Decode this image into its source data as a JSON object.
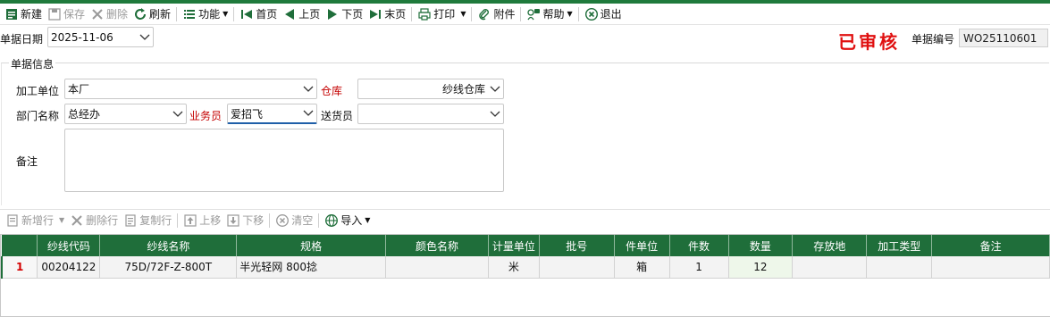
{
  "toolbar": {
    "new": "新建",
    "save": "保存",
    "delete": "删除",
    "refresh": "刷新",
    "functions": "功能",
    "first": "首页",
    "prev": "上页",
    "next": "下页",
    "last": "末页",
    "print": "打印",
    "attachment": "附件",
    "help": "帮助",
    "exit": "退出"
  },
  "header": {
    "date_label": "单据日期",
    "date_value": "2025-11-06",
    "status": "已审核",
    "doc_no_label": "单据编号",
    "doc_no_value": "WO25110601"
  },
  "form": {
    "group_title": "单据信息",
    "processing_unit_label": "加工单位",
    "processing_unit_value": "本厂",
    "warehouse_label": "仓库",
    "warehouse_value": "纱线仓库",
    "dept_label": "部门名称",
    "dept_value": "总经办",
    "salesman_label": "业务员",
    "salesman_value": "爱招飞",
    "deliverer_label": "送货员",
    "deliverer_value": "",
    "remark_label": "备注",
    "remark_value": ""
  },
  "detail_toolbar": {
    "add_row": "新增行",
    "delete_row": "删除行",
    "copy_row": "复制行",
    "move_up": "上移",
    "move_down": "下移",
    "clear": "清空",
    "import": "导入"
  },
  "grid": {
    "columns": [
      "",
      "纱线代码",
      "纱线名称",
      "规格",
      "颜色名称",
      "计量单位",
      "批号",
      "件单位",
      "件数",
      "数量",
      "存放地",
      "加工类型",
      "备注"
    ],
    "rows": [
      [
        "1",
        "00204122",
        "75D/72F-Z-800T",
        "半光轻网  800捻",
        "",
        "米",
        "",
        "箱",
        "1",
        "12",
        "",
        "",
        ""
      ]
    ]
  },
  "colors": {
    "brand_green": "#1f6e3a",
    "status_red": "#e01010",
    "required_red": "#c40000"
  }
}
